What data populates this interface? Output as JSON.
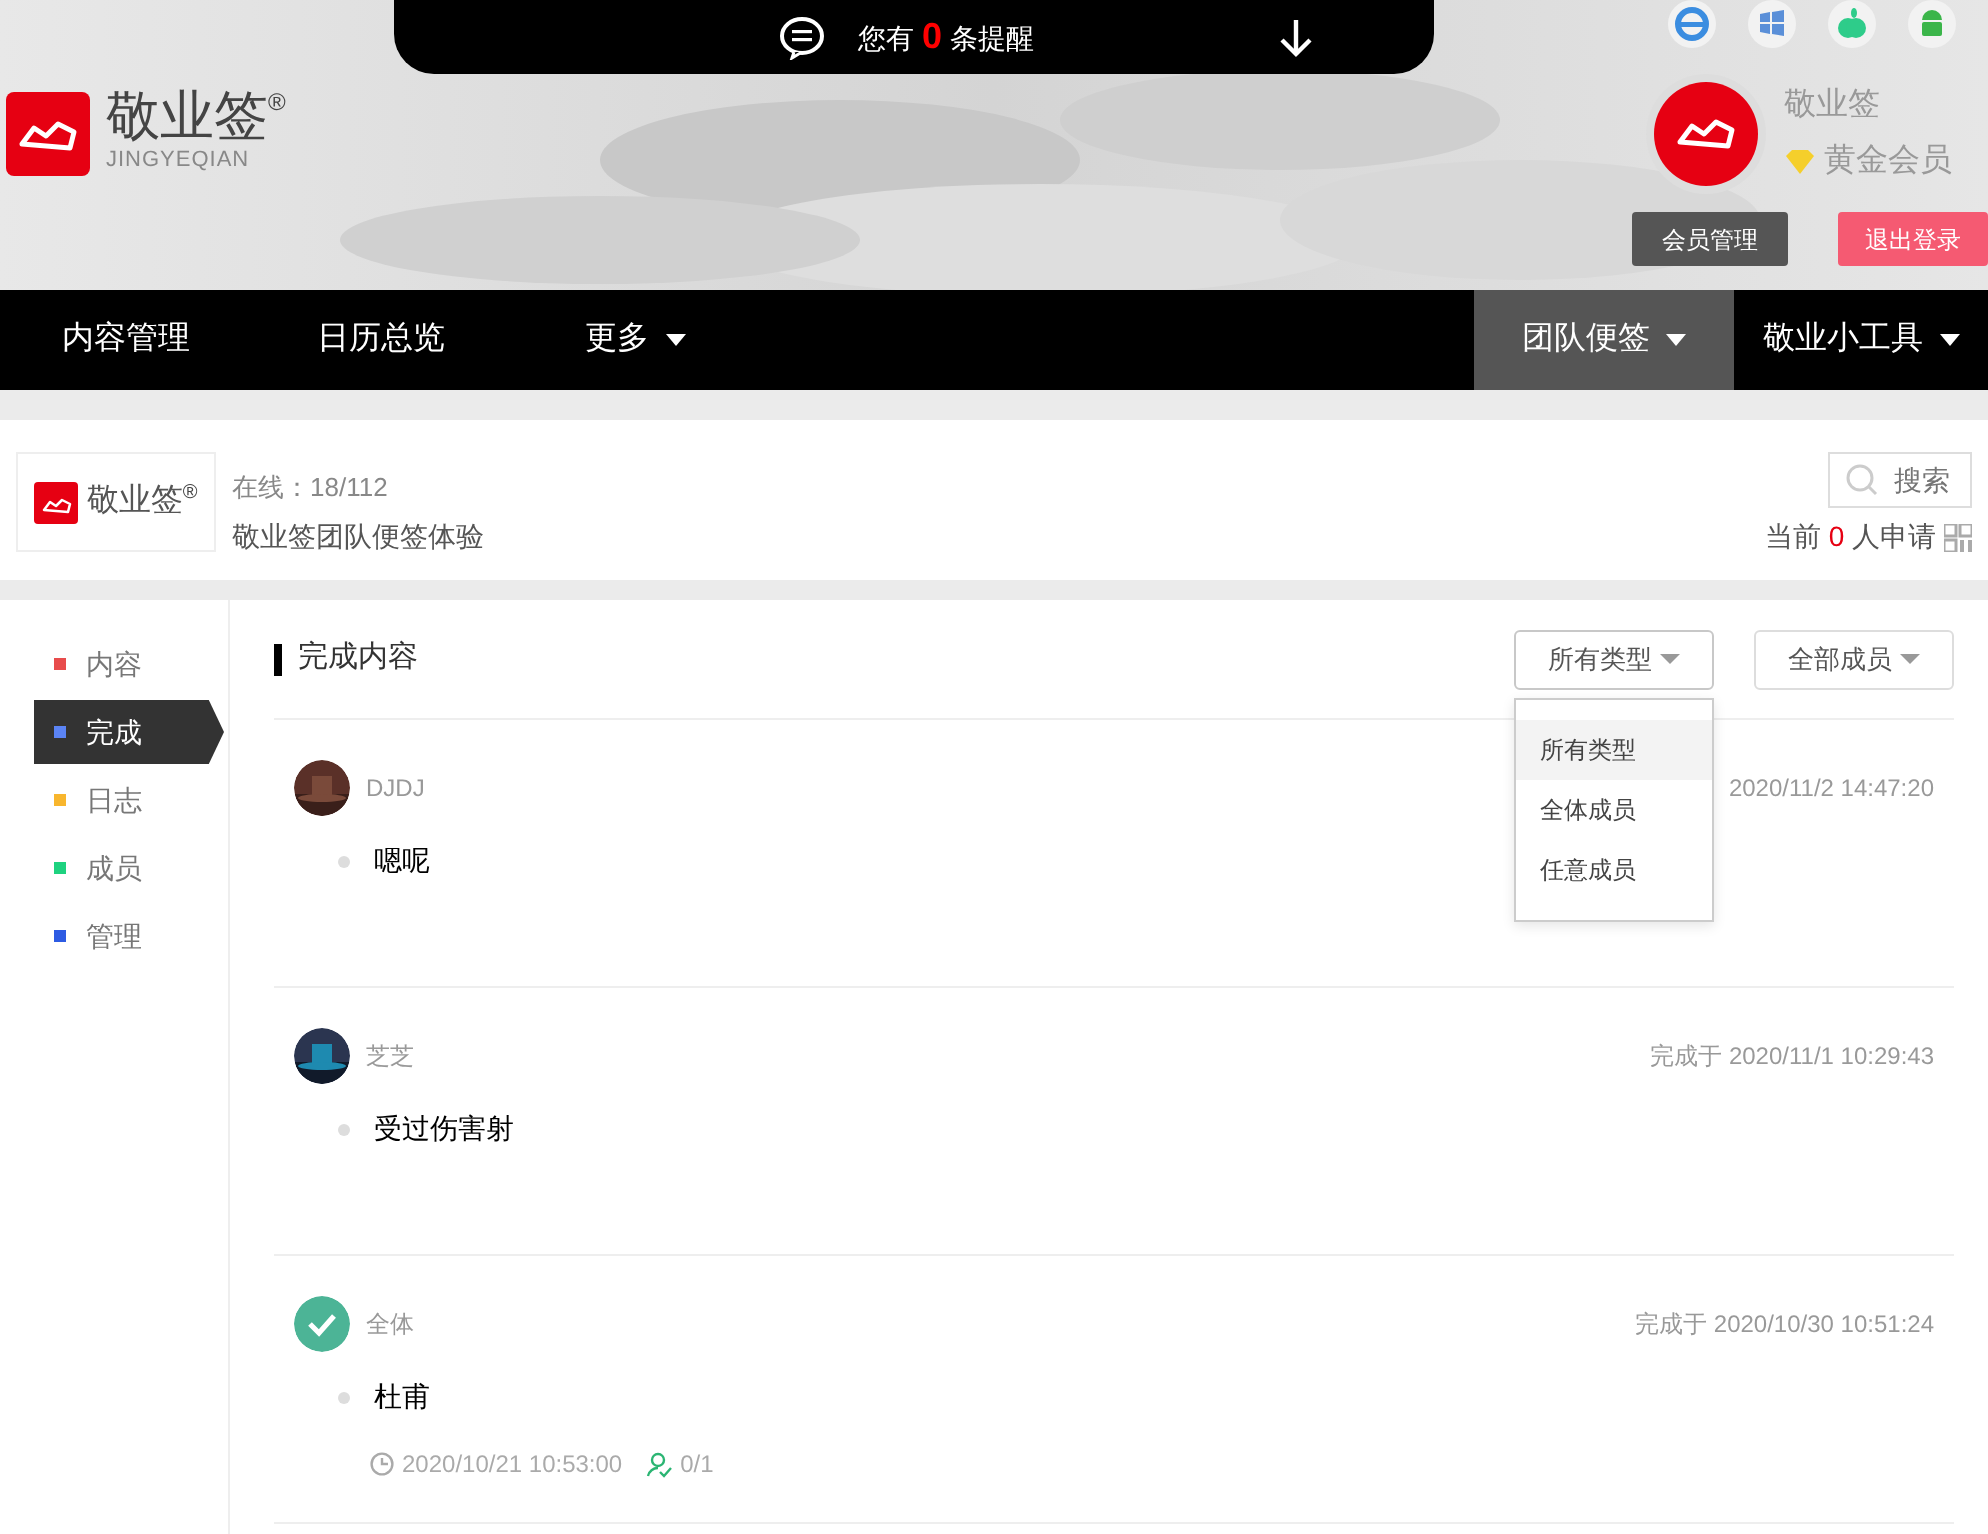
{
  "notice_bar": {
    "prefix": "您有",
    "count": "0",
    "suffix": "条提醒"
  },
  "logo": {
    "name": "敬业签",
    "mark": "®",
    "subtitle": "JINGYEQIAN"
  },
  "user": {
    "name": "敬业签",
    "level": "黄金会员"
  },
  "header_buttons": [
    {
      "label": "会员管理",
      "kind": "dark"
    },
    {
      "label": "退出登录",
      "kind": "danger"
    }
  ],
  "nav_left": [
    {
      "label": "内容管理",
      "dropdown": false,
      "selected": false
    },
    {
      "label": "日历总览",
      "dropdown": false,
      "selected": false
    },
    {
      "label": "更多",
      "dropdown": true,
      "selected": false
    }
  ],
  "nav_right": [
    {
      "label": "团队便签",
      "dropdown": true,
      "selected": true
    },
    {
      "label": "敬业小工具",
      "dropdown": true,
      "selected": false
    }
  ],
  "team": {
    "logo_name": "敬业签",
    "logo_mark": "®",
    "online": "在线：18/112",
    "name": "敬业签团队便签体验",
    "search_placeholder": "搜索",
    "applicants": {
      "prefix": "当前",
      "count": "0",
      "suffix": "人申请"
    }
  },
  "sidebar": [
    {
      "label": "内容",
      "color": "#e84c4c",
      "selected": false
    },
    {
      "label": "完成",
      "color": "#5b84f5",
      "selected": true
    },
    {
      "label": "日志",
      "color": "#f8b62d",
      "selected": false
    },
    {
      "label": "成员",
      "color": "#1ed27f",
      "selected": false
    },
    {
      "label": "管理",
      "color": "#2d5be3",
      "selected": false
    }
  ],
  "content": {
    "title": "完成内容",
    "filters": [
      {
        "label": "所有类型",
        "expanded": true
      },
      {
        "label": "全部成员",
        "expanded": false
      }
    ],
    "dropdown_options": [
      {
        "label": "所有类型",
        "selected": true
      },
      {
        "label": "全体成员",
        "selected": false
      },
      {
        "label": "任意成员",
        "selected": false
      }
    ],
    "items": [
      {
        "author": "DJDJ",
        "completed": "2020/11/2 14:47:20",
        "text": "嗯呢"
      },
      {
        "author": "芝芝",
        "completed": "完成于 2020/11/1 10:29:43",
        "text": "受过伤害射"
      },
      {
        "kind": "check",
        "author": "全体",
        "completed": "完成于 2020/10/30 10:51:24",
        "text": "杜甫",
        "time": "2020/10/21 10:53:00",
        "progress": "0/1"
      }
    ]
  }
}
